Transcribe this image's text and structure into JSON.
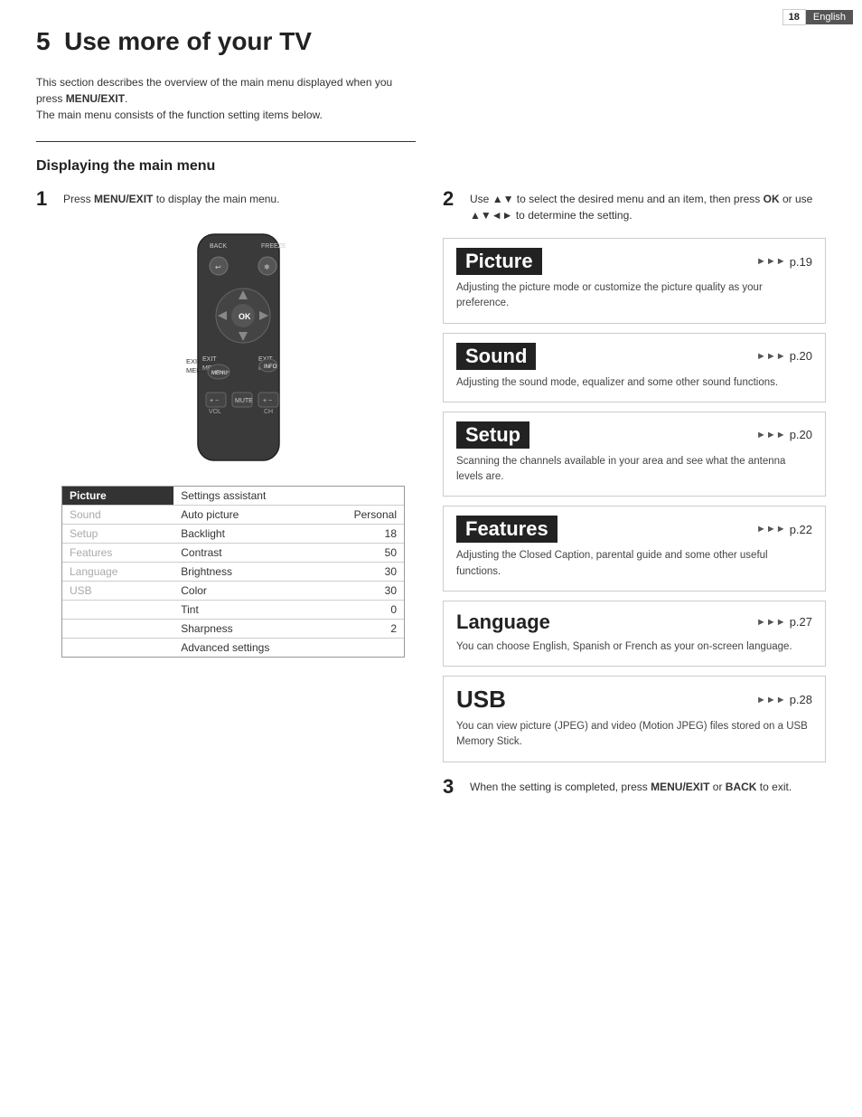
{
  "page": {
    "number": "18",
    "language": "English"
  },
  "chapter": {
    "number": "5",
    "title": "Use more of your TV"
  },
  "intro": {
    "line1": "This section describes the overview of the main menu displayed when",
    "line2": "you press ",
    "menu_exit": "MENU/EXIT",
    "line3": ".",
    "line4": "The main menu consists of the function setting items below."
  },
  "section_heading": "Displaying the main menu",
  "step1": {
    "num": "1",
    "text_before": "Press ",
    "bold": "MENU/EXIT",
    "text_after": " to display the main menu."
  },
  "step2": {
    "num": "2",
    "text_before": "Use ",
    "bold1": "▲▼",
    "text_mid": " to select the desired menu and an item, then press ",
    "bold2": "OK",
    "text_after": " or use ",
    "bold3": "▲▼◄►",
    "text_end": " to determine the setting."
  },
  "step3": {
    "num": "3",
    "text_before": "When the setting is completed, press ",
    "bold1": "MENU/EXIT",
    "text_mid": " or ",
    "bold2": "BACK",
    "text_after": " to exit."
  },
  "remote": {
    "back_label": "BACK",
    "freeze_label": "FREEZE",
    "ok_label": "OK",
    "exit_label": "EXIT",
    "menu_label": "MENU",
    "exit2_label": "EXIT",
    "info_label": "INFO",
    "vol_label": "VOL",
    "mute_label": "MUTE",
    "ch_label": "CH"
  },
  "menu_items": {
    "left_col": [
      "Picture",
      "Sound",
      "Setup",
      "Features",
      "Language",
      "USB"
    ],
    "selected": "Picture",
    "right_col_label": "Settings assistant",
    "rows": [
      {
        "label": "Auto picture",
        "value": "Personal"
      },
      {
        "label": "Backlight",
        "value": "18"
      },
      {
        "label": "Contrast",
        "value": "50"
      },
      {
        "label": "Brightness",
        "value": "30"
      },
      {
        "label": "Color",
        "value": "30"
      },
      {
        "label": "Tint",
        "value": "0"
      },
      {
        "label": "Sharpness",
        "value": "2"
      },
      {
        "label": "Advanced settings",
        "value": ""
      }
    ]
  },
  "cards": [
    {
      "title": "Picture",
      "title_style": "inverted",
      "page_ref": "p.19",
      "desc": "Adjusting the picture mode or customize the picture quality as your preference."
    },
    {
      "title": "Sound",
      "title_style": "inverted",
      "page_ref": "p.20",
      "desc": "Adjusting the sound mode, equalizer and some other sound functions."
    },
    {
      "title": "Setup",
      "title_style": "inverted",
      "page_ref": "p.20",
      "desc": "Scanning the channels available in your area and see what the antenna levels are."
    },
    {
      "title": "Features",
      "title_style": "inverted",
      "page_ref": "p.22",
      "desc": "Adjusting the Closed Caption, parental guide and some other useful functions."
    },
    {
      "title": "Language",
      "title_style": "normal",
      "page_ref": "p.27",
      "desc": "You can choose English, Spanish or French as your on-screen language."
    },
    {
      "title": "USB",
      "title_style": "normal",
      "page_ref": "p.28",
      "desc": "You can view picture (JPEG) and video (Motion JPEG) files stored on a USB Memory Stick."
    }
  ]
}
